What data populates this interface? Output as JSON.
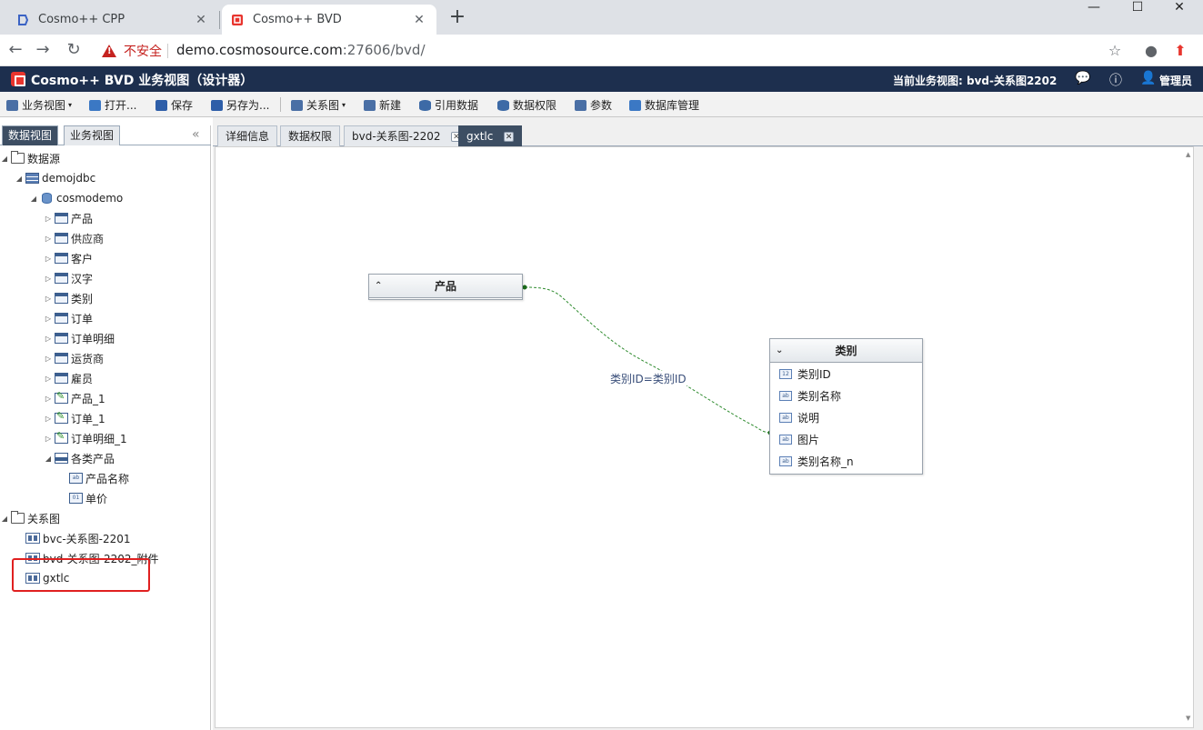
{
  "browser": {
    "tabs": [
      {
        "label": "Cosmo++ CPP",
        "close": "✕"
      },
      {
        "label": "Cosmo++ BVD",
        "close": "✕"
      }
    ],
    "newtab": "+",
    "window": {
      "min": "—",
      "max": "☐",
      "close": "✕"
    },
    "nav": {
      "back": "←",
      "forward": "→",
      "reload": "↻"
    },
    "security_label": "不安全",
    "url_host": "demo.cosmosource.com",
    "url_rest": ":27606/bvd/",
    "star": "☆",
    "account": "●",
    "update": "⬆"
  },
  "app": {
    "title": "Cosmo++ BVD 业务视图（设计器）",
    "current_view": "当前业务视图: bvd-关系图2202",
    "user": "管理员",
    "icons": {
      "chat": "💬",
      "info": "ⓘ",
      "user": "👤"
    }
  },
  "toolbar": {
    "business_view": "业务视图",
    "open": "打开...",
    "save": "保存",
    "save_as": "另存为...",
    "relation": "关系图",
    "new": "新建",
    "ref_data": "引用数据",
    "data_perm": "数据权限",
    "params": "参数",
    "db_manage": "数据库管理",
    "caret": "▾"
  },
  "left": {
    "tabs": [
      "数据视图",
      "业务视图"
    ],
    "collapse": "«",
    "tree": {
      "datasource": "数据源",
      "conn": "demojdbc",
      "db": "cosmodemo",
      "tables": [
        "产品",
        "供应商",
        "客户",
        "汉字",
        "类别",
        "订单",
        "订单明细",
        "运货商",
        "雇员"
      ],
      "queries": [
        "产品_1",
        "订单_1",
        "订单明细_1"
      ],
      "sql": "各类产品",
      "sql_fields": [
        "产品名称",
        "单价"
      ],
      "relations_root": "关系图",
      "relations": [
        "bvc-关系图-2201",
        "bvd-关系图-2202_附件",
        "gxtlc"
      ]
    },
    "arrows": {
      "expanded": "◢",
      "collapsed": "▷"
    }
  },
  "right": {
    "tabs": [
      {
        "label": "详细信息"
      },
      {
        "label": "数据权限"
      },
      {
        "label": "bvd-关系图-2202",
        "close": "✕"
      },
      {
        "label": "gxtlc",
        "close": "✕"
      }
    ],
    "scroll_up": "▲",
    "scroll_down": "▼",
    "entities": {
      "product": {
        "title": "产品",
        "chev": "⌃"
      },
      "category": {
        "title": "类别",
        "chev": "⌄",
        "fields": [
          {
            "name": "类别ID",
            "type": "12"
          },
          {
            "name": "类别名称",
            "type": "ab"
          },
          {
            "name": "说明",
            "type": "ab"
          },
          {
            "name": "图片",
            "type": "ab"
          },
          {
            "name": "类别名称_n",
            "type": "ab"
          }
        ]
      }
    },
    "relation_label": "类别ID=类别ID"
  },
  "colors": {
    "header_bg": "#1d2f4e",
    "active_tab": "#3d4e63",
    "relation_line": "#2e8b2e",
    "highlight": "#e02020"
  }
}
